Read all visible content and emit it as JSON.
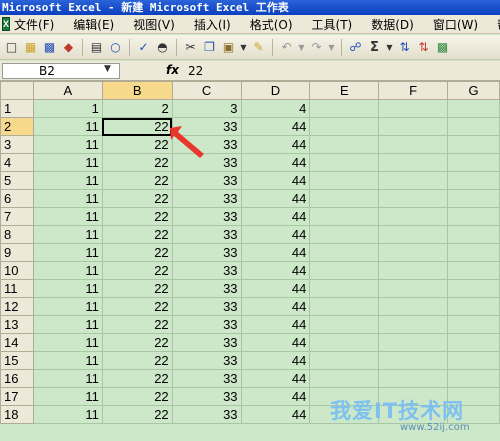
{
  "window": {
    "title": "Microsoft Excel - 新建 Microsoft Excel 工作表"
  },
  "menu": [
    "文件(F)",
    "编辑(E)",
    "视图(V)",
    "插入(I)",
    "格式(O)",
    "工具(T)",
    "数据(D)",
    "窗口(W)",
    "帮"
  ],
  "toolbar": {
    "icons": [
      "new-icon",
      "open-icon",
      "save-icon",
      "permission-icon",
      "print-icon",
      "print-preview-icon",
      "spelling-icon",
      "research-icon",
      "cut-icon",
      "copy-icon",
      "paste-icon",
      "format-painter-icon",
      "undo-icon",
      "redo-icon",
      "hyperlink-icon",
      "autosum-icon",
      "sort-ascending-icon",
      "sort-descending-icon",
      "chart-icon"
    ],
    "autosum_label": "Σ"
  },
  "formula_bar": {
    "name_box": "B2",
    "fx_label": "fx",
    "value": "22"
  },
  "sheet": {
    "columns": [
      "A",
      "B",
      "C",
      "D",
      "E",
      "F",
      "G"
    ],
    "rows": [
      {
        "n": "1",
        "cells": [
          "1",
          "2",
          "3",
          "4"
        ]
      },
      {
        "n": "2",
        "cells": [
          "11",
          "22",
          "33",
          "44"
        ]
      },
      {
        "n": "3",
        "cells": [
          "11",
          "22",
          "33",
          "44"
        ]
      },
      {
        "n": "4",
        "cells": [
          "11",
          "22",
          "33",
          "44"
        ]
      },
      {
        "n": "5",
        "cells": [
          "11",
          "22",
          "33",
          "44"
        ]
      },
      {
        "n": "6",
        "cells": [
          "11",
          "22",
          "33",
          "44"
        ]
      },
      {
        "n": "7",
        "cells": [
          "11",
          "22",
          "33",
          "44"
        ]
      },
      {
        "n": "8",
        "cells": [
          "11",
          "22",
          "33",
          "44"
        ]
      },
      {
        "n": "9",
        "cells": [
          "11",
          "22",
          "33",
          "44"
        ]
      },
      {
        "n": "10",
        "cells": [
          "11",
          "22",
          "33",
          "44"
        ]
      },
      {
        "n": "11",
        "cells": [
          "11",
          "22",
          "33",
          "44"
        ]
      },
      {
        "n": "12",
        "cells": [
          "11",
          "22",
          "33",
          "44"
        ]
      },
      {
        "n": "13",
        "cells": [
          "11",
          "22",
          "33",
          "44"
        ]
      },
      {
        "n": "14",
        "cells": [
          "11",
          "22",
          "33",
          "44"
        ]
      },
      {
        "n": "15",
        "cells": [
          "11",
          "22",
          "33",
          "44"
        ]
      },
      {
        "n": "16",
        "cells": [
          "11",
          "22",
          "33",
          "44"
        ]
      },
      {
        "n": "17",
        "cells": [
          "11",
          "22",
          "33",
          "44"
        ]
      },
      {
        "n": "18",
        "cells": [
          "11",
          "22",
          "33",
          "44"
        ]
      }
    ],
    "selected_cell": "B2"
  },
  "watermark": {
    "main": "我爱IT技术网",
    "sub": "www.52ij.com"
  },
  "colors": {
    "sheet_bg": "#cde8c9",
    "title_bar": "#0a3fbf",
    "annotation_arrow": "#e8382e"
  }
}
